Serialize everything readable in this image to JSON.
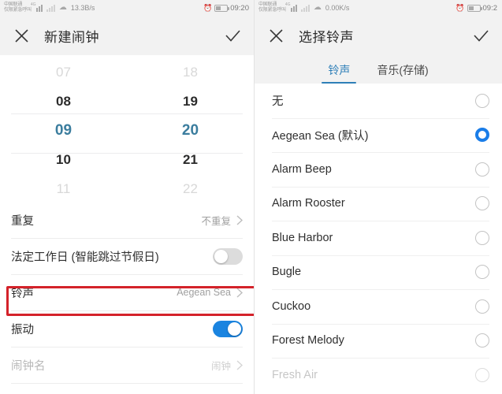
{
  "left_screen": {
    "status_bar": {
      "carrier_line1": "中国联通",
      "carrier_line2": "仅限紧急呼叫",
      "network_tag": "4G",
      "net_speed": "13.3B/s",
      "clock": "09:20",
      "alarm_icon": "alarm-clock-icon",
      "battery_icon": "battery-icon",
      "wifi_icon": "wifi-icon"
    },
    "app_bar": {
      "close_icon": "close-icon",
      "title": "新建闹钟",
      "confirm_icon": "check-icon"
    },
    "time_picker": {
      "hours": [
        "07",
        "08",
        "09",
        "10",
        "11"
      ],
      "minutes": [
        "18",
        "19",
        "20",
        "21",
        "22"
      ],
      "selected_hour": "09",
      "selected_minute": "20",
      "selected_color": "#3b7d9e"
    },
    "settings": [
      {
        "label": "重复",
        "value": "不重复",
        "type": "nav"
      },
      {
        "label": "法定工作日 (智能跳过节假日)",
        "type": "toggle",
        "on": false
      },
      {
        "label": "铃声",
        "value": "Aegean Sea",
        "type": "nav",
        "highlighted": true
      },
      {
        "label": "振动",
        "type": "toggle",
        "on": true
      },
      {
        "label": "闹钟名",
        "value": "闹钟",
        "type": "nav",
        "muted": true
      }
    ],
    "highlight_color": "#d4222a"
  },
  "right_screen": {
    "status_bar": {
      "carrier_line1": "中国联通",
      "carrier_line2": "仅限紧急呼叫",
      "network_tag": "4G",
      "net_speed": "0.00K/s",
      "clock": "09:2",
      "alarm_icon": "alarm-clock-icon",
      "battery_icon": "battery-icon",
      "wifi_icon": "wifi-icon"
    },
    "app_bar": {
      "close_icon": "close-icon",
      "title": "选择铃声",
      "confirm_icon": "check-icon"
    },
    "tabs": [
      {
        "label": "铃声",
        "active": true
      },
      {
        "label": "音乐(存储)",
        "active": false
      }
    ],
    "tab_accent": "#2e7fb8",
    "ringtones": [
      {
        "name": "无",
        "selected": false
      },
      {
        "name": "Aegean Sea (默认)",
        "selected": true
      },
      {
        "name": "Alarm Beep",
        "selected": false
      },
      {
        "name": "Alarm Rooster",
        "selected": false
      },
      {
        "name": "Blue Harbor",
        "selected": false
      },
      {
        "name": "Bugle",
        "selected": false
      },
      {
        "name": "Cuckoo",
        "selected": false
      },
      {
        "name": "Forest Melody",
        "selected": false
      },
      {
        "name": "Fresh Air",
        "selected": false,
        "faded": true
      }
    ],
    "radio_accent": "#1a7de8"
  }
}
